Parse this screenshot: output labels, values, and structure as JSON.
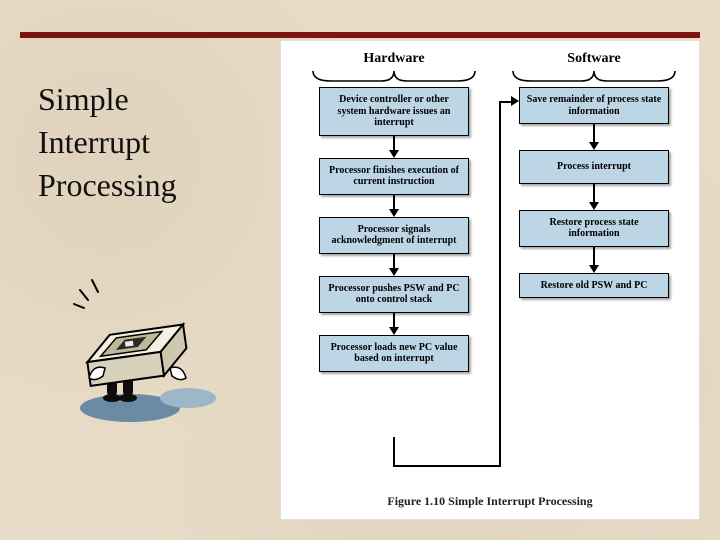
{
  "title_lines": [
    "Simple",
    "Interrupt",
    "Processing"
  ],
  "figure": {
    "columns": {
      "hardware": {
        "header": "Hardware",
        "nodes": [
          "Device controller or other system hardware issues an interrupt",
          "Processor finishes execution of current instruction",
          "Processor signals acknowledgment of interrupt",
          "Processor pushes PSW and PC onto control stack",
          "Processor loads new PC value based on interrupt"
        ]
      },
      "software": {
        "header": "Software",
        "nodes": [
          "Save remainder of process state information",
          "Process interrupt",
          "Restore process state information",
          "Restore old PSW and PC"
        ]
      }
    },
    "caption": "Figure 1.10   Simple Interrupt Processing"
  },
  "colors": {
    "rule": "#7a1410",
    "node_fill": "#bcd6e5",
    "bg": "#e8dcc8"
  }
}
